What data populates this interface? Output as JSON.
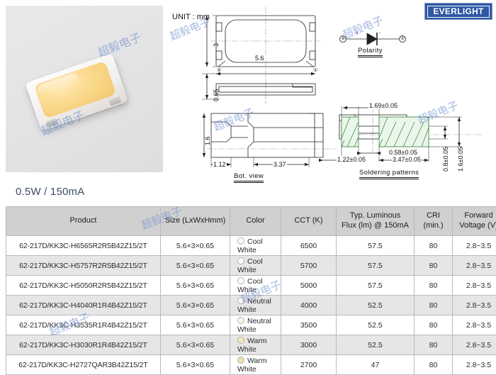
{
  "brand": {
    "logo_text": "EVERLIGHT",
    "logo_color": "#2e57a4"
  },
  "drawing": {
    "unit_label": "UNIT : mm",
    "top_view": {
      "height_dim": "3",
      "width_dim": "5.6",
      "thickness_dim": "0.65",
      "pin2_marker": "②",
      "pin1_marker": "①"
    },
    "bottom_view": {
      "caption": "Bot. view",
      "height_dim": "1.6",
      "left_dim": "1.12",
      "center_dim": "3.37"
    },
    "polarity": {
      "caption": "Polarity",
      "anode_marker": "②",
      "cathode_marker": "①",
      "plus_sign": "+",
      "minus_sign": "-"
    },
    "soldering": {
      "caption": "Soldering patterns",
      "dim_top": "1.69±0.05",
      "dim_gap": "0.58±0.05",
      "dim_left": "1.22±0.05",
      "dim_pad": "3.47±0.05",
      "dim_inner_h": "0.8±0.05",
      "dim_outer_h": "1.6±0.05"
    }
  },
  "heading": "0.5W / 150mA",
  "watermark_text": "超毅电子",
  "table": {
    "columns": [
      "Product",
      "Size (LxWxHmm)",
      "Color",
      "CCT (K)",
      "Typ. Luminous Flux (lm) @ 150mA",
      "CRI (min.)",
      "Forward Voltage (V)"
    ],
    "columns_multiline": [
      [
        "Product"
      ],
      [
        "Size (LxWxHmm)"
      ],
      [
        "Color"
      ],
      [
        "CCT (K)"
      ],
      [
        "Typ. Luminous",
        "Flux (lm) @ 150mA"
      ],
      [
        "CRI",
        "(min.)"
      ],
      [
        "Forward",
        "Voltage (V)"
      ]
    ],
    "rows": [
      {
        "product": "62-217D/KK3C-H6565R2R5B42Z15/2T",
        "size": "5.6×3×0.65",
        "color": "Cool White",
        "color_hex": "#fcfcfa",
        "cct": "6500",
        "flux": "57.5",
        "cri": "80",
        "vf": "2.8~3.5"
      },
      {
        "product": "62-217D/KK3C-H5757R2R5B42Z15/2T",
        "size": "5.6×3×0.65",
        "color": "Cool White",
        "color_hex": "#fdfdfb",
        "cct": "5700",
        "flux": "57.5",
        "cri": "80",
        "vf": "2.8~3.5"
      },
      {
        "product": "62-217D/KK3C-H5050R2R5B42Z15/2T",
        "size": "5.6×3×0.65",
        "color": "Cool White",
        "color_hex": "#fdfcf6",
        "cct": "5000",
        "flux": "57.5",
        "cri": "80",
        "vf": "2.8~3.5"
      },
      {
        "product": "62-217D/KK3C-H4040R1R4B42Z15/2T",
        "size": "5.6×3×0.65",
        "color": "Neutral White",
        "color_hex": "#fbf8ea",
        "cct": "4000",
        "flux": "52.5",
        "cri": "80",
        "vf": "2.8~3.5"
      },
      {
        "product": "62-217D/KK3C-H3535R1R4B42Z15/2T",
        "size": "5.6×3×0.65",
        "color": "Neutral White",
        "color_hex": "#faf5e0",
        "cct": "3500",
        "flux": "52.5",
        "cri": "80",
        "vf": "2.8~3.5"
      },
      {
        "product": "62-217D/KK3C-H3030R1R4B42Z15/2T",
        "size": "5.6×3×0.65",
        "color": "Warm White",
        "color_hex": "#f5e9b6",
        "cct": "3000",
        "flux": "52.5",
        "cri": "80",
        "vf": "2.8~3.5"
      },
      {
        "product": "62-217D/KK3C-H2727QAR3B42Z15/2T",
        "size": "5.6×3×0.65",
        "color": "Warm White",
        "color_hex": "#efdfa4",
        "cct": "2700",
        "flux": "47",
        "cri": "80",
        "vf": "2.8~3.5"
      }
    ]
  }
}
